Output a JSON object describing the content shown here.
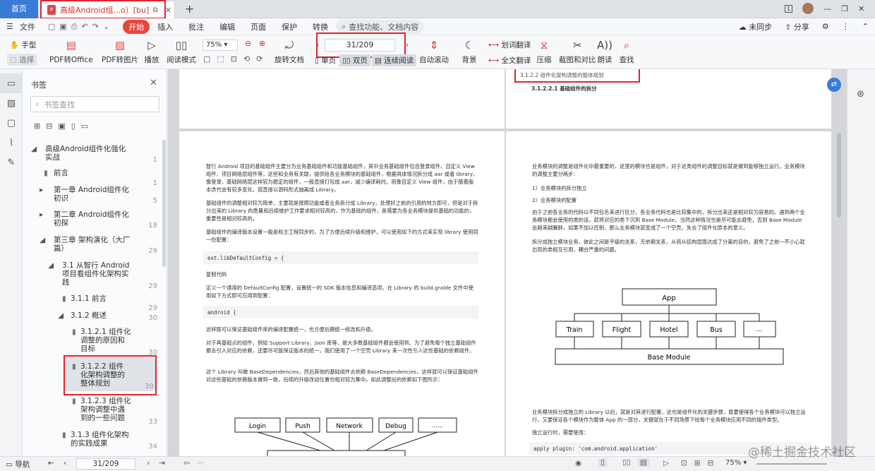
{
  "tabs": {
    "home": "首页",
    "doc": "高级Android组...o）[bu].pdf"
  },
  "menu": [
    "文件",
    "开始",
    "插入",
    "批注",
    "编辑",
    "页面",
    "保护",
    "转换"
  ],
  "menu_search": "查找功能、文档内容",
  "menu_right": {
    "sync": "未同步",
    "share": "分享"
  },
  "ribbon": {
    "hand": "手型",
    "select": "选择",
    "pdf_office": "PDF转Office",
    "pdf_image": "PDF转图片",
    "play": "播放",
    "read_mode": "阅读模式",
    "zoom": "75%",
    "rotate": "旋转文档",
    "page_input": "31/209",
    "single": "单页",
    "double": "双页",
    "continuous": "连续阅读",
    "auto_scroll": "自动滚动",
    "background": "背景",
    "word_translate": "划词翻译",
    "full_translate": "全文翻译",
    "compress": "压缩",
    "screenshot": "截图和对比",
    "read_aloud": "朗读",
    "find": "查找"
  },
  "panel": {
    "title": "书签",
    "search_placeholder": "书签查找",
    "items": [
      {
        "label": "高级Android组件化强化实战",
        "num": "1"
      },
      {
        "label": "前言",
        "num": "1"
      },
      {
        "label": "第一章 Android组件化初识",
        "num": "5"
      },
      {
        "label": "第二章 Android组件化初探",
        "num": "18"
      },
      {
        "label": "第三章 架构演化（大厂篇）",
        "num": "29"
      },
      {
        "label": "3.1 从智行 Android 项目看组件化架构实践",
        "num": "29"
      },
      {
        "label": "3.1.1 前言",
        "num": "29"
      },
      {
        "label": "3.1.2 概述",
        "num": "30"
      },
      {
        "label": "3.1.2.1 组件化调整的原因和目标",
        "num": "30"
      },
      {
        "label": "3.1.2.2 组件化架构调整的整体规划",
        "num": "30"
      },
      {
        "label": "3.1.2.3 组件化架构调整中遇到的一些问题",
        "num": "33"
      },
      {
        "label": "3.1.3 组件化架构的实践成果",
        "num": "34"
      }
    ]
  },
  "page_top_right": {
    "heading": "3.1.2.2 组件化架构调整的整体规划",
    "sub": "3.1.2.2.1 基础组件的拆分"
  },
  "left_page": {
    "p1": "智行 Android 项目的基础组件主要分为业务基础组件和功能基础组件，其中业务基础组件包含登录组件、自定义 View 组件、项目网络层组件等，这些和业务有关联，提供给各业务模块的基础组件，根据具体情况拆分成 aar 或者 library，像登录，基础网络层这样较为稳定的组件，一般直接打包成 aar，减少编译耗时。而像自定义 View 组件，由于随着版本迭代会有较多变化，就直接以源码形式抽离成 Library。",
    "p2": "基础组件的调整相对较为简单，主要就是按照功能或者业务拆分成 Library，处理好之前的引用的地方即可，但是对于拆分出来的 Library 的质量和后续维护工作要求相对较高的，作为基础的组件，是需要为各业务模块提供基础的功能的，重要性是相对较高的。",
    "p3": "基础组件的编译版本设置一般是和主工程同步的，为了方便后续升级和维护，可以使用如下的方式来实现 library 使用同一份配置：",
    "code1": "ext.libDefaultConfig = {",
    "p4": "复制代码",
    "p5": "定义一个通用的 DefaultConfig 配置，设置统一的 SDK 版本信息和编译选项，在 Library 的 build.gralde 文件中使用如下方式即可应用到配置：",
    "code2": "android {",
    "p6": "这样既可以保证基础组件库的编译配置统一，也方便后期统一修改和升级。",
    "p7": "对于再基础点的组件，例如 Support Library、json 库等，绝大多数基础组件都会使用到。为了避免每个独立基础组件都去引入对应的依赖，还要尽可能保证版本的统一，我们使用了一个空壳 Library 来一次性引入这些基础的依赖组件。",
    "p8": "这个 Library 叫做 BaseDependencies，然后其他的基础组件去依赖 BaseDependencies，这样就可以保证基础组件对这些基础的依赖版本做到一致，后续的升级改动位置也相对较为集中。如此调整后的依赖如下图所示：",
    "diagram": [
      "Login",
      "Push",
      "Network",
      "Debug",
      "……"
    ]
  },
  "right_page": {
    "p1": "业务模块的调整是组件化中最重要的，这里的模块也是组件，对于这类组件的调整目标就是做到能够独立运行。业务模块的调整主要分两步：",
    "p2": "1）业务模块的拆分独立",
    "p3": "2）业务模块的配置",
    "p4": "由于之前各业务的代码以不同包名来进行区分，各业务代码也是比较集中的，拆分出来还是相对较为容易的。遇到两个业务模块都会使用的类的话，就将对应的类下沉到 Base Module，当然这种情况也是尽可能去避免，否则 Base Module 会越来越臃肿，如果不加以控制，那么业务模块就变成了一个空壳，失去了组件化原本的意义。",
    "p5": "拆分成独立模块业务，彼此之间是平级的关系，无依赖关系，从而从结构层面达成了分离的目的，避免了之前一不小心就出现的类相互引用，耦合严重的问题。",
    "diagram": {
      "top": "App",
      "mid": [
        "Train",
        "Flight",
        "Hotel",
        "Bus",
        "…"
      ],
      "bottom": "Base Module"
    },
    "p6": "业务模块拆分成独立的 Library 以后，就是对其进行配置，这也是组件化的关键步骤，既要使得各个业务模块可以独立运行，又要保证各个模块作为整体 App 的一部分，关键就在于不同场景下给每个业务模块应用不同的插件类型。",
    "p7": "独立运行时，需要使用：",
    "code": "apply plugin: 'com.android.application'"
  },
  "status": {
    "nav": "导航",
    "page": "31/209",
    "zoom": "75%"
  },
  "watermark": "@稀土掘金技术社区"
}
